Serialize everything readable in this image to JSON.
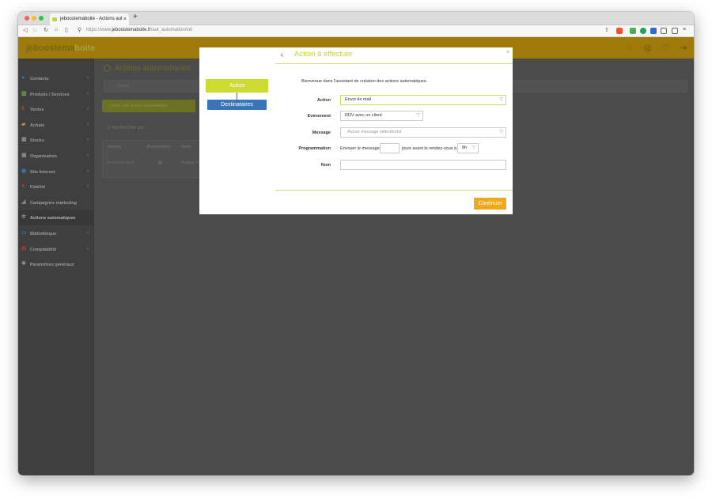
{
  "browser": {
    "tab_title": "jeboostemaboite - Actions aut",
    "tab_close": "×",
    "new_tab": "+",
    "url_prefix": "https://www.",
    "url_domain": "jeboostemaboite.fr",
    "url_path": "/aut_automation/init"
  },
  "app": {
    "logo_part1": "jeboostema",
    "logo_part2": "boite"
  },
  "sidebar": {
    "items": [
      {
        "label": "Contacts",
        "icon": "person-icon",
        "chevron": true
      },
      {
        "label": "Produits / Services",
        "icon": "products-icon",
        "chevron": true
      },
      {
        "label": "Ventes",
        "icon": "euro-icon",
        "chevron": true
      },
      {
        "label": "Achats",
        "icon": "cart-icon",
        "chevron": true
      },
      {
        "label": "Stocks",
        "icon": "boxes-icon",
        "chevron": true
      },
      {
        "label": "Organisation",
        "icon": "calendar-icon",
        "chevron": true
      },
      {
        "label": "Site Internet",
        "icon": "globe-icon",
        "chevron": true
      },
      {
        "label": "Fidélité",
        "icon": "heart-icon",
        "chevron": true
      },
      {
        "label": "Campagnes marketing",
        "icon": "megaphone-icon",
        "chevron": false
      },
      {
        "label": "Actions automatiques",
        "icon": "gear-icon",
        "chevron": false
      },
      {
        "label": "Bibliothèque",
        "icon": "folder-icon",
        "chevron": true
      },
      {
        "label": "Comptabilité",
        "icon": "scale-icon",
        "chevron": true
      },
      {
        "label": "Paramètres généraux",
        "icon": "settings-icon",
        "chevron": false
      }
    ]
  },
  "main": {
    "title": "Actions automatiques",
    "band_text": "Actions",
    "new_button": "Créer une action automatique",
    "search_placeholder": "Rechercher par...",
    "table_headers": [
      "Action",
      "Événement",
      "Nom"
    ],
    "table_row": [
      "Envoi de mail",
      "",
      "Rappel d..."
    ]
  },
  "modal": {
    "steps": [
      "Action",
      "Destinataires"
    ],
    "title": "Action à effectuer",
    "back_icon": "‹",
    "close_icon": "×",
    "welcome": "Bienvenue dans l'assistant de création des actions automatiques.",
    "labels": {
      "action": "Action",
      "event": "Evènement",
      "message": "Message",
      "programmation": "Programmation",
      "name": "Nom"
    },
    "fields": {
      "action_value": "Envoi de mail",
      "event_value": "RDV avec un client",
      "message_placeholder": "Aucun message sélectionné",
      "prog_prefix": "Envoyer le message",
      "prog_days_value": "",
      "prog_middle": "jours avant le rendez-vous à",
      "prog_hour_value": "8h",
      "name_value": ""
    },
    "continue_label": "Continuer"
  },
  "colors": {
    "accent_green": "#cbdb2f",
    "accent_blue": "#3a74b8",
    "accent_orange": "#f0a81c"
  }
}
